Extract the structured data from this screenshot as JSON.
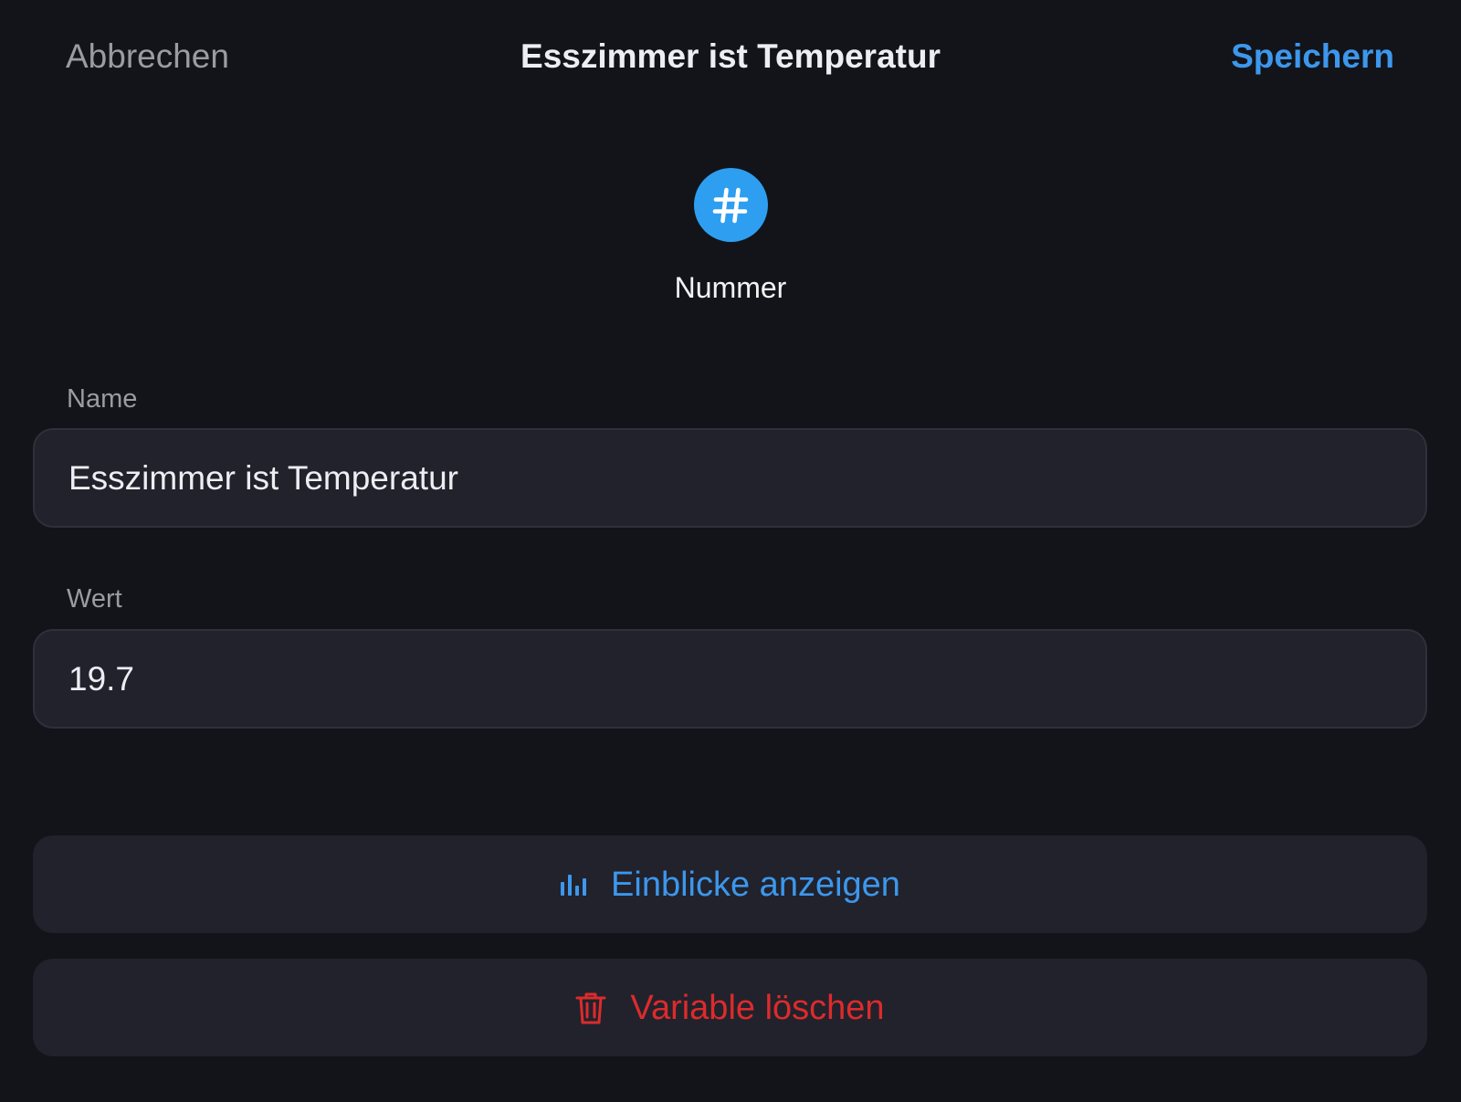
{
  "header": {
    "cancel_label": "Abbrechen",
    "title": "Esszimmer ist Temperatur",
    "save_label": "Speichern"
  },
  "type": {
    "icon": "hash-icon",
    "label": "Nummer"
  },
  "fields": {
    "name": {
      "label": "Name",
      "value": "Esszimmer ist Temperatur"
    },
    "value": {
      "label": "Wert",
      "value": "19.7"
    }
  },
  "actions": {
    "insights": {
      "icon": "bar-chart-icon",
      "label": "Einblicke anzeigen"
    },
    "delete": {
      "icon": "trash-icon",
      "label": "Variable löschen"
    }
  },
  "colors": {
    "background": "#12141a",
    "surface": "#21222c",
    "accent_blue": "#3d97ec",
    "type_circle": "#2e9ff0",
    "danger_red": "#dd2b2b",
    "muted_text": "#9a9ca2"
  }
}
